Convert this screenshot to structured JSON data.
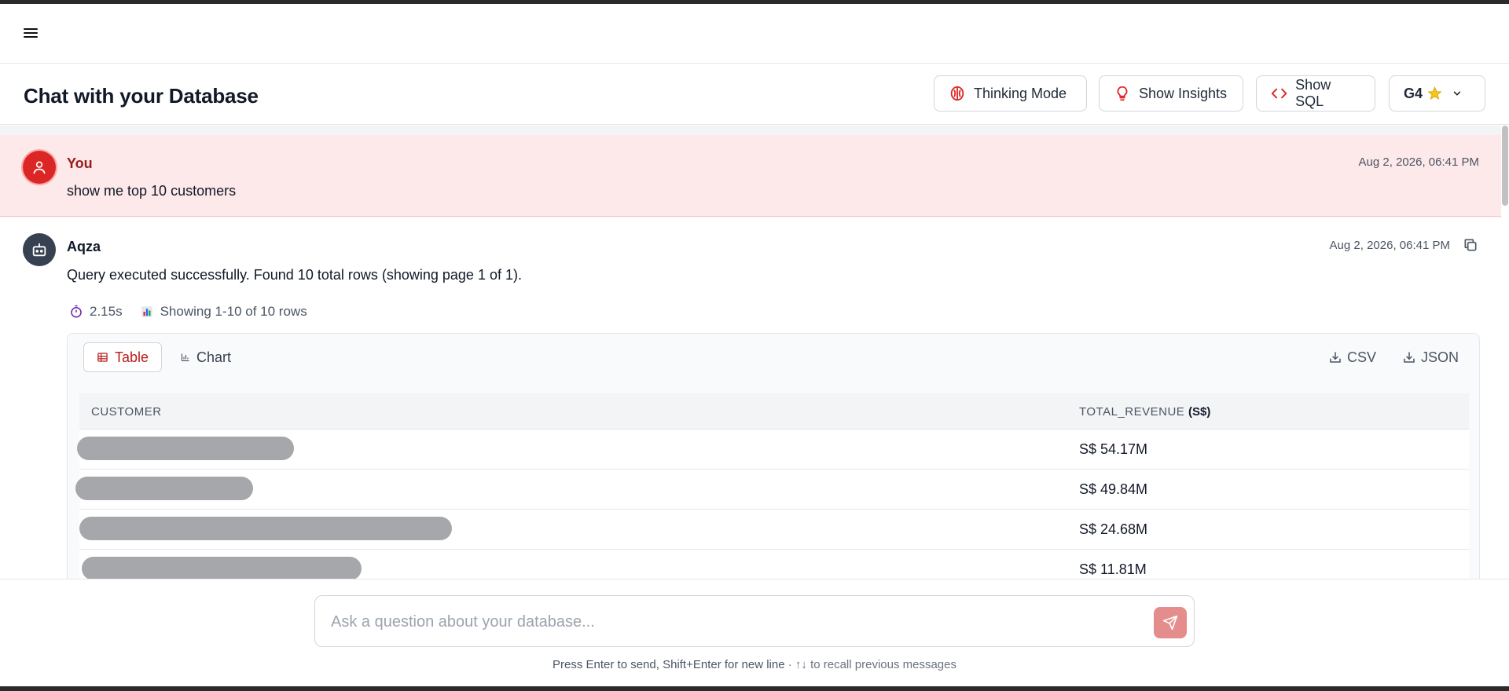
{
  "header": {
    "title": "Chat with your Database",
    "buttons": {
      "thinking": "Thinking Mode",
      "insights": "Show Insights",
      "sql": "Show SQL",
      "model": "G4"
    }
  },
  "messages": {
    "user": {
      "sender": "You",
      "timestamp": "Aug 2, 2026, 06:41 PM",
      "text": "show me top 10 customers"
    },
    "bot": {
      "sender": "Aqza",
      "timestamp": "Aug 2, 2026, 06:41 PM",
      "text": "Query executed successfully. Found 10 total rows (showing page 1 of 1).",
      "duration": "2.15s",
      "rows_summary": "Showing 1-10 of 10 rows"
    }
  },
  "results": {
    "tabs": {
      "table": "Table",
      "chart": "Chart"
    },
    "exports": {
      "csv": "CSV",
      "json": "JSON"
    },
    "columns": {
      "customer": "CUSTOMER",
      "revenue": "TOTAL_REVENUE",
      "revenue_unit": "(S$)"
    },
    "rows": [
      {
        "customer": "",
        "revenue": "S$ 54.17M"
      },
      {
        "customer": "",
        "revenue": "S$ 49.84M"
      },
      {
        "customer": "",
        "revenue": "S$ 24.68M"
      },
      {
        "customer": "",
        "revenue": "S$ 11.81M"
      }
    ]
  },
  "composer": {
    "placeholder": "Ask a question about your database...",
    "hint_main": "Press Enter to send, Shift+Enter for new line",
    "hint_recall": " · ↑↓ to recall previous messages"
  },
  "colors": {
    "accent": "#dc2626",
    "user_bg": "#fde8ea",
    "send_button": "#e58c8c"
  }
}
